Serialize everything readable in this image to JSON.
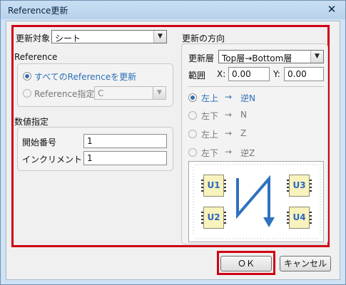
{
  "window": {
    "title": "Reference更新",
    "close_symbol": "✕"
  },
  "left": {
    "target_label": "更新対象",
    "target_value": "シート",
    "reference_group_title": "Reference",
    "radio_update_all": "すべてのReferenceを更新",
    "radio_specify": "Reference指定",
    "reference_select_value": "C",
    "numeric_group_title": "数値指定",
    "start_label": "開始番号",
    "start_value": "1",
    "increment_label": "インクリメント",
    "increment_value": "1"
  },
  "right": {
    "direction_title": "更新の方向",
    "layer_label": "更新層",
    "layer_value": "Top層→Bottom層",
    "range_label": "範囲",
    "x_label": "X:",
    "x_value": "0.00",
    "y_label": "Y:",
    "y_value": "0.00",
    "options": [
      {
        "from": "左上",
        "arrow": "→",
        "to": "逆N",
        "selected": true
      },
      {
        "from": "左下",
        "arrow": "→",
        "to": "N",
        "selected": false
      },
      {
        "from": "左上",
        "arrow": "→",
        "to": "Z",
        "selected": false
      },
      {
        "from": "左下",
        "arrow": "→",
        "to": "逆Z",
        "selected": false
      }
    ],
    "diagram_chips": [
      "U1",
      "U2",
      "U3",
      "U4"
    ]
  },
  "buttons": {
    "ok": "ＯＫ",
    "cancel": "キャンセル"
  },
  "colors": {
    "accent_red": "#d00014",
    "selected_blue": "#2b6fb8",
    "path_blue": "#2f72bf",
    "chip_fill": "#f8f2bc"
  }
}
